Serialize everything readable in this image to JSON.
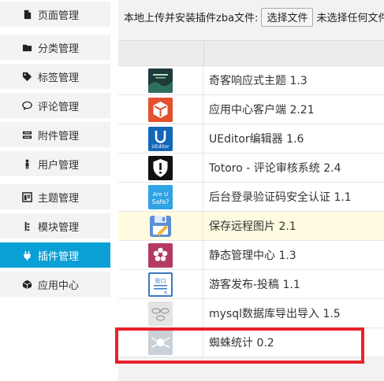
{
  "sidebar": {
    "items": [
      {
        "label": "页面管理",
        "icon": "page-icon"
      },
      {
        "label": "分类管理",
        "icon": "folder-icon"
      },
      {
        "label": "标签管理",
        "icon": "tag-icon"
      },
      {
        "label": "评论管理",
        "icon": "comment-icon"
      },
      {
        "label": "附件管理",
        "icon": "attachment-icon"
      },
      {
        "label": "用户管理",
        "icon": "user-icon"
      },
      {
        "label": "主题管理",
        "icon": "theme-icon"
      },
      {
        "label": "模块管理",
        "icon": "module-icon"
      },
      {
        "label": "插件管理",
        "icon": "plugin-icon",
        "active": true
      },
      {
        "label": "应用中心",
        "icon": "app-center-icon"
      }
    ],
    "active_color": "#0aa0d6"
  },
  "upload": {
    "label": "本地上传并安装插件zba文件:",
    "button": "选择文件",
    "status": "未选择任何文件"
  },
  "plugins": [
    {
      "name": "奇客响应式主题 1.3",
      "icon": "qike-theme-icon",
      "color": "#1f3a3a"
    },
    {
      "name": "应用中心客户端 2.21",
      "icon": "app-center-client-icon",
      "color": "#e2502d"
    },
    {
      "name": "UEditor编辑器 1.6",
      "icon": "ueditor-icon",
      "color": "#1466b8",
      "logo_text": "UEditor"
    },
    {
      "name": "Totoro - 评论审核系统 2.4",
      "icon": "totoro-shield-icon",
      "color": "#111111"
    },
    {
      "name": "后台登录验证码安全认证 1.1",
      "icon": "safe-captcha-icon",
      "color": "#2fa3e6",
      "logo_text": "Are U Safe?"
    },
    {
      "name": "保存远程图片 2.1",
      "icon": "save-remote-image-icon",
      "color": "#5b8fd6",
      "highlight": true
    },
    {
      "name": "静态管理中心 1.3",
      "icon": "static-manager-icon",
      "color": "#b33a63"
    },
    {
      "name": "游客发布-投稿 1.1",
      "icon": "guest-post-icon",
      "color": "#3b78c2",
      "logo_text": "投口稿"
    },
    {
      "name": "mysql数据库导出导入 1.5",
      "icon": "mysql-export-icon",
      "color": "#d8d8d8"
    },
    {
      "name": "蜘蛛统计 0.2",
      "icon": "spider-stats-icon",
      "color": "#c8d0d8"
    }
  ]
}
